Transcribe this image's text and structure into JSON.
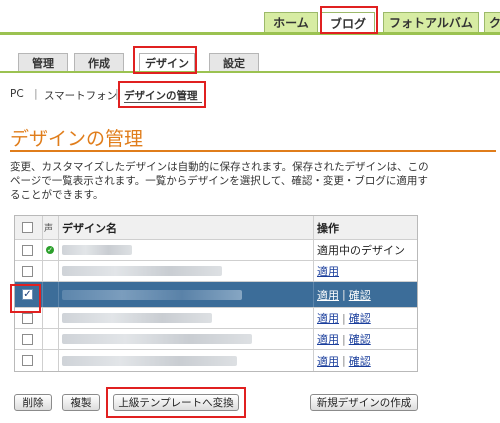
{
  "top_tabs": [
    {
      "label": "ホーム"
    },
    {
      "label": "ブログ"
    },
    {
      "label": "フォトアルバム"
    },
    {
      "label": "ク"
    }
  ],
  "sub_tabs": [
    {
      "label": "管理"
    },
    {
      "label": "作成"
    },
    {
      "label": "デザイン"
    },
    {
      "label": "設定"
    }
  ],
  "breadcrumb": {
    "pc": "PC",
    "sep1": "|",
    "smartphone": "スマートフォン",
    "sep2": "|",
    "current": "デザインの管理"
  },
  "page_title": "デザインの管理",
  "description": "変更、カスタマイズしたデザインは自動的に保存されます。保存されたデザインは、このページで一覧表示されます。一覧からデザインを選択して、確認・変更・ブログに適用することができます。",
  "table": {
    "headers": {
      "select": "",
      "flag": "声",
      "name": "デザイン名",
      "action": "操作"
    },
    "rows": [
      {
        "checked": false,
        "applied": true,
        "action_text": "適用中のデザイン",
        "apply": "",
        "sep": "",
        "confirm": ""
      },
      {
        "checked": false,
        "applied": false,
        "action_text": "",
        "apply": "適用",
        "sep": "",
        "confirm": ""
      },
      {
        "checked": true,
        "applied": false,
        "action_text": "",
        "apply": "適用",
        "sep": "|",
        "confirm": "確認",
        "selected": true
      },
      {
        "checked": false,
        "applied": false,
        "action_text": "",
        "apply": "適用",
        "sep": "|",
        "confirm": "確認"
      },
      {
        "checked": false,
        "applied": false,
        "action_text": "",
        "apply": "適用",
        "sep": "|",
        "confirm": "確認"
      },
      {
        "checked": false,
        "applied": false,
        "action_text": "",
        "apply": "適用",
        "sep": "|",
        "confirm": "確認"
      }
    ]
  },
  "buttons": {
    "delete": "削除",
    "copy": "複製",
    "convert": "上級テンプレートへ変換",
    "new_design": "新規デザインの作成"
  },
  "icons": {
    "applied_icon": "check-circle-icon",
    "checkbox_mark": "✓",
    "applied_mark": "✓"
  },
  "colors": {
    "accent_orange": "#e07d1b",
    "tab_green": "#9bc251",
    "selected_row": "#3c6d99",
    "highlight_red": "#e02020",
    "link_blue": "#1a3e9c"
  }
}
